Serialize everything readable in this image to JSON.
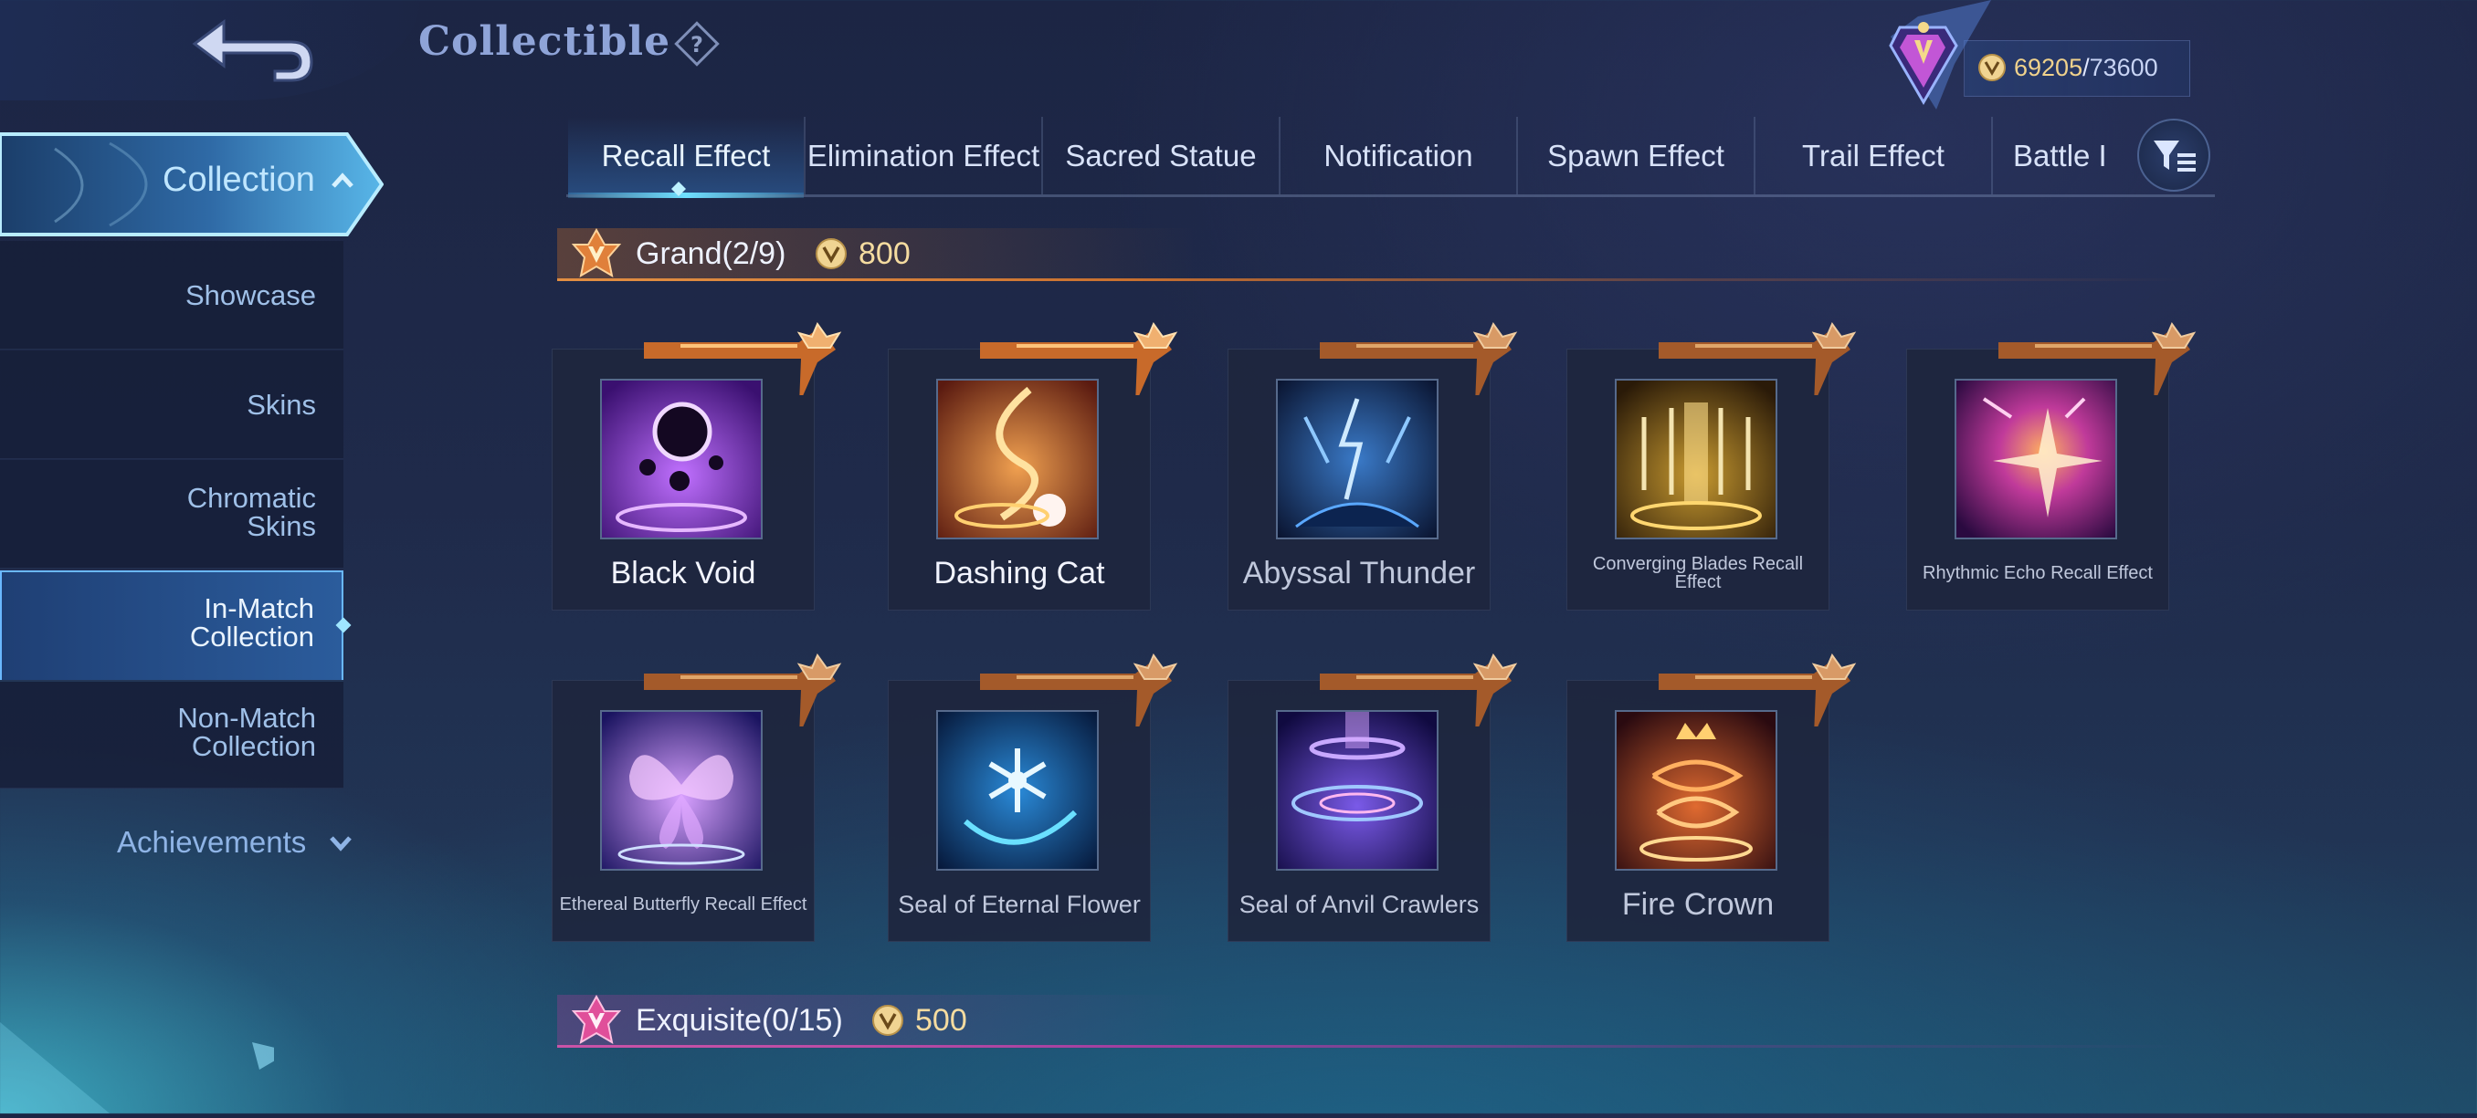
{
  "header": {
    "title": "Collectible",
    "points_current": "69205",
    "points_separator": "/",
    "points_total": "73600"
  },
  "sidebar": {
    "collection_label": "Collection",
    "items": [
      {
        "label": "Showcase"
      },
      {
        "label": "Skins"
      },
      {
        "label": "Chromatic Skins"
      },
      {
        "label": "In-Match Collection"
      },
      {
        "label": "Non-Match Collection"
      }
    ],
    "achievements_label": "Achievements"
  },
  "tabs": [
    {
      "label": "Recall Effect",
      "active": true
    },
    {
      "label": "Elimination Effect"
    },
    {
      "label": "Sacred Statue"
    },
    {
      "label": "Notification"
    },
    {
      "label": "Spawn Effect"
    },
    {
      "label": "Trail Effect"
    },
    {
      "label": "Battle I"
    }
  ],
  "sections": {
    "grand": {
      "title": "Grand(2/9)",
      "price": "800"
    },
    "exquisite": {
      "title": "Exquisite(0/15)",
      "price": "500"
    }
  },
  "cards": [
    {
      "name": "Black Void",
      "owned": true
    },
    {
      "name": "Dashing Cat",
      "owned": true
    },
    {
      "name": "Abyssal Thunder",
      "owned": false
    },
    {
      "name": "Converging Blades Recall Effect",
      "owned": false
    },
    {
      "name": "Rhythmic Echo Recall Effect",
      "owned": false
    },
    {
      "name": "Ethereal Butterfly Recall Effect",
      "owned": false
    },
    {
      "name": "Seal of Eternal Flower",
      "owned": false
    },
    {
      "name": "Seal of Anvil Crawlers",
      "owned": false
    },
    {
      "name": "Fire Crown",
      "owned": false
    }
  ],
  "colors": {
    "accent_cyan": "#6fe0ff",
    "gold": "#f5dca0",
    "grand_orange": "#e0803a",
    "exquisite_pink": "#e04f9a"
  }
}
